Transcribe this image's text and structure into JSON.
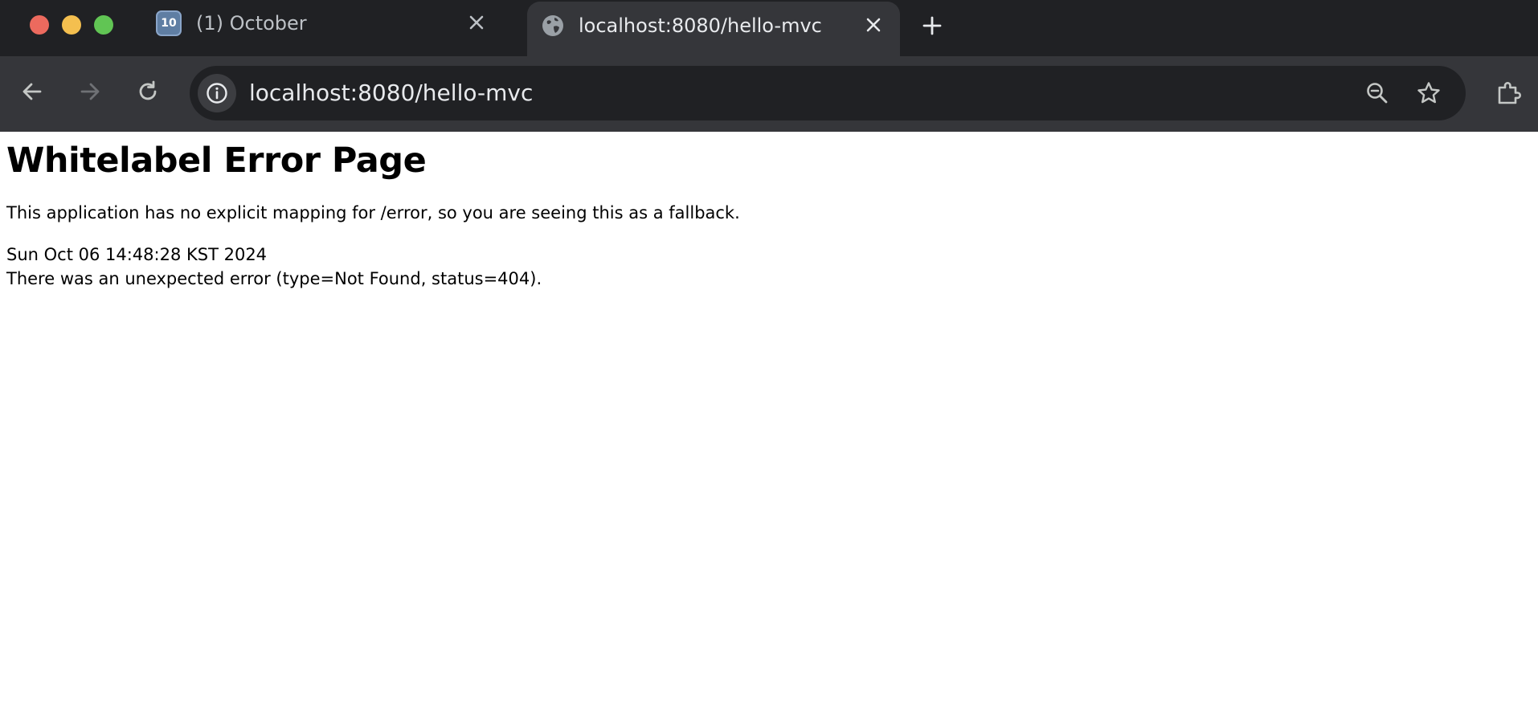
{
  "window": {
    "controls": [
      "close",
      "minimize",
      "maximize"
    ]
  },
  "tabs": [
    {
      "icon": "keycap-ten-icon",
      "favicon_text": "10",
      "title": "(1) October",
      "active": false
    },
    {
      "icon": "globe-icon",
      "title": "localhost:8080/hello-mvc",
      "active": true
    }
  ],
  "toolbar": {
    "url": "localhost:8080/hello-mvc"
  },
  "page": {
    "title": "Whitelabel Error Page",
    "message": "This application has no explicit mapping for /error, so you are seeing this as a fallback.",
    "timestamp": "Sun Oct 06 14:48:28 KST 2024",
    "error": "There was an unexpected error (type=Not Found, status=404)."
  },
  "colors": {
    "tabstrip_bg": "#202124",
    "toolbar_bg": "#35363a",
    "omnibox_bg": "#202124",
    "text_light": "#e8eaed",
    "close_red": "#ec6a5e",
    "minimize_yellow": "#f4bf4f",
    "maximize_green": "#61c554"
  }
}
